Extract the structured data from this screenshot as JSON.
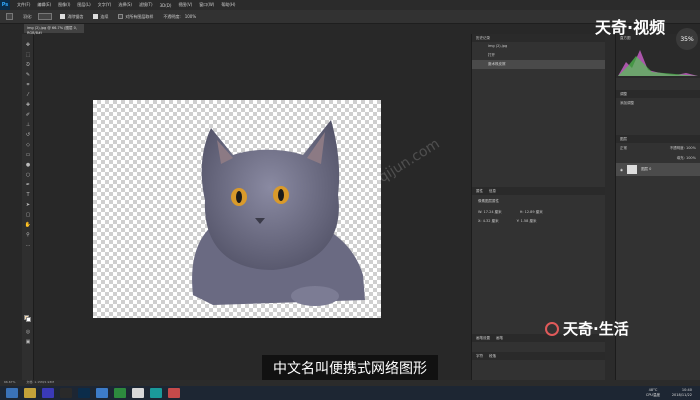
{
  "app": {
    "name": "Ps"
  },
  "menubar": {
    "items": [
      "文件(F)",
      "编辑(E)",
      "图像(I)",
      "图层(L)",
      "文字(Y)",
      "选择(S)",
      "滤镜(T)",
      "3D(D)",
      "视图(V)",
      "窗口(W)",
      "帮助(H)"
    ]
  },
  "options": {
    "feather_label": "羽化:",
    "antialias_label": "消除锯齿",
    "contiguous_label": "连续",
    "sample_all_label": "对所有图层取样",
    "opacity_label": "不透明度:",
    "opacity_value": "100%"
  },
  "document": {
    "tab_title": "img (2).jpg @ 66.7% (图层 0, RGB/8#)"
  },
  "history": {
    "header": "历史记录",
    "snapshot": "img (2).jpg",
    "items": [
      "打开",
      "魔术橡皮擦"
    ]
  },
  "histogram_header": "直方图",
  "adjustments": {
    "header": "调整",
    "subtitle": "添加调整"
  },
  "properties": {
    "header": "属性",
    "tab2": "信息",
    "subtitle": "像素图层属性",
    "w": "W: 17.24 厘米",
    "h": "H: 12.89 厘米",
    "x": "X: 4.32 厘米",
    "y": "Y: 1.58 厘米"
  },
  "layers": {
    "header": "图层",
    "blend_mode": "正常",
    "opacity": "不透明度: 100%",
    "fill": "填充: 100%",
    "layer_name": "图层 0"
  },
  "bottom_tabs": {
    "a": "画笔设置",
    "b": "画笔",
    "c": "字符",
    "d": "段落"
  },
  "statusbar": {
    "zoom": "66.67%",
    "doc": "文档: 1.15M/1.93M"
  },
  "overlay": {
    "brand_top": "天奇·视频",
    "brand_bottom": "天奇·生活",
    "subtitle": "中文名叫便携式网络图形",
    "badge": "35%"
  },
  "taskbar": {
    "time": "10:40",
    "date": "2018/11/22",
    "tray_text": "CPU温度",
    "tray_temp": "48°C"
  },
  "colors": {
    "accent": "#31a8ff",
    "brand_circle": "#e05a5a"
  }
}
